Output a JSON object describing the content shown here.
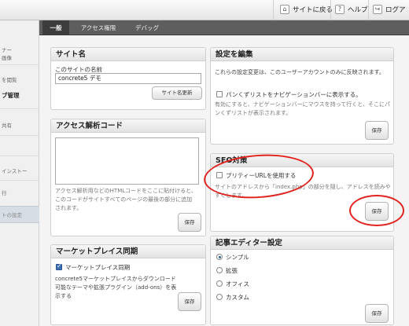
{
  "topbar": {
    "back_to_site": "サイトに戻る",
    "help": "ヘルプ",
    "logout": "ログア"
  },
  "sidebar": {
    "items": [
      {
        "text": "ナー"
      },
      {
        "text": "画像"
      },
      {
        "text": "を閲覧"
      },
      {
        "text": "ブ管理"
      },
      {
        "text": "共有"
      },
      {
        "text": "インストー"
      },
      {
        "text": "行"
      },
      {
        "text": "トの設定"
      }
    ]
  },
  "tabs": [
    {
      "label": "一般"
    },
    {
      "label": "アクセス権限"
    },
    {
      "label": "デバッグ"
    }
  ],
  "site_name": {
    "title": "サイト名",
    "field_label": "このサイトの名前",
    "value": "concrete5 デモ",
    "update_button": "サイト名更新"
  },
  "analytics": {
    "title": "アクセス解析コード",
    "help": "アクセス解析用などのHTMLコードをここに貼付けると、このコードがサイトすべてのページの最後の部分に追加されます。",
    "save_button": "保存"
  },
  "marketplace": {
    "title": "マーケットプレイス同期",
    "checkbox_label": "マーケットプレイス同期",
    "checked": true,
    "help": "concrete5マーケットプレイスからダウンロード可能なテーマや拡張プラグイン（add-ons）を表示する",
    "save_button": "保存"
  },
  "edit_settings": {
    "title": "設定を編集",
    "description": "これらの設定変更は、このユーザーアカウントのみに反映されます。",
    "checkbox_label": "パンくずリストをナビゲーションバーに表示する。",
    "checked": false,
    "help": "有効にすると、ナビゲーションバーにマウスを持って行くと、そこにパンくずリストが表示されます。",
    "save_button": "保存"
  },
  "seo": {
    "title": "SEO対策",
    "checkbox_label": "プリティーURLを使用する",
    "checked": false,
    "help": "サイトのアドレスから「index.php」の部分を隠し、アドレスを読みやすくします。",
    "save_button": "保存"
  },
  "editor": {
    "title": "記事エディター設定",
    "options": [
      {
        "label": "シンプル",
        "selected": true
      },
      {
        "label": "拡張",
        "selected": false
      },
      {
        "label": "オフィス",
        "selected": false
      },
      {
        "label": "カスタム",
        "selected": false
      }
    ],
    "save_button": "保存"
  },
  "colors": {
    "annotation": "#e0231e",
    "tab_bar": "#5e5e5e",
    "tab_active": "#3c3c3c"
  }
}
